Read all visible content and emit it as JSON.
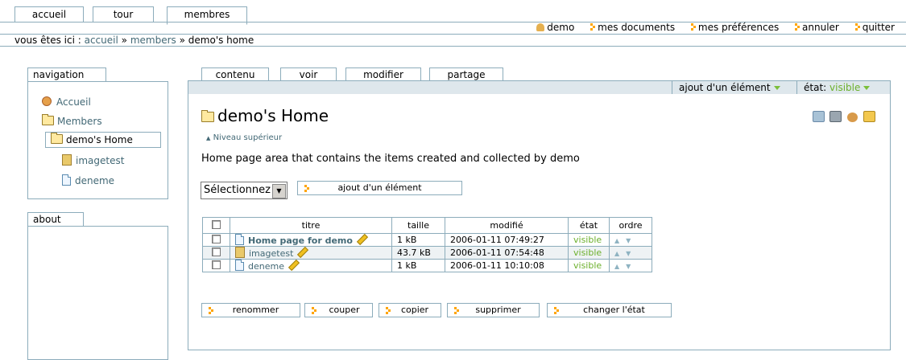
{
  "top_tabs": [
    "accueil",
    "tour",
    "membres"
  ],
  "personal_bar": {
    "user": "demo",
    "my_documents": "mes documents",
    "preferences": "mes préférences",
    "undo": "annuler",
    "logout": "quitter"
  },
  "breadcrumb": {
    "prefix": "vous êtes ici :",
    "items": [
      "accueil",
      "members",
      "demo's home"
    ],
    "separator": "»"
  },
  "navigation": {
    "title": "navigation",
    "items": [
      "Accueil",
      "Members",
      "demo's Home",
      "imagetest",
      "deneme"
    ]
  },
  "about": {
    "title": "about"
  },
  "content_tabs": [
    "contenu",
    "voir",
    "modifier",
    "partage"
  ],
  "content_actions": {
    "add_item": "ajout d'un élément",
    "state_label": "état:",
    "state_value": "visible"
  },
  "folder": {
    "title": "demo's Home",
    "up_level": "Niveau supérieur",
    "description": "Home page area that contains the items created and collected by demo"
  },
  "add_form": {
    "select_value": "Sélectionnez",
    "add_button": "ajout d'un élément"
  },
  "table": {
    "headers": [
      "titre",
      "taille",
      "modifié",
      "état",
      "ordre"
    ],
    "rows": [
      {
        "title": "Home page for demo",
        "size": "1 kB",
        "modified": "2006-01-11 07:49:27",
        "state": "visible"
      },
      {
        "title": "imagetest",
        "size": "43.7 kB",
        "modified": "2006-01-11 07:54:48",
        "state": "visible"
      },
      {
        "title": "deneme",
        "size": "1 kB",
        "modified": "2006-01-11 10:10:08",
        "state": "visible"
      }
    ]
  },
  "bottom_buttons": [
    "renommer",
    "couper",
    "copier",
    "supprimer",
    "changer l'état"
  ],
  "colors": {
    "link": "#436976",
    "border": "#8cacbb",
    "bar": "#dee7ec",
    "state_green": "#6cb02c",
    "accent_orange": "#ffa500"
  }
}
